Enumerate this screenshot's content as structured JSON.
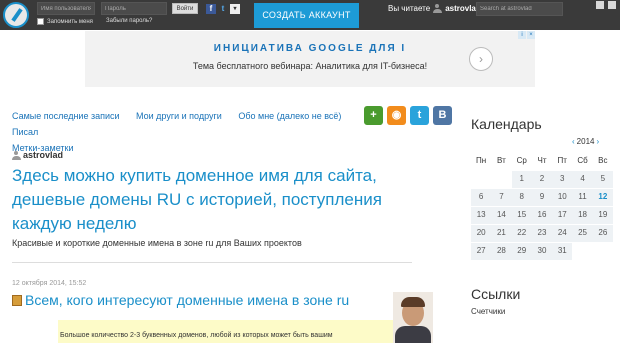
{
  "topbar": {
    "login_placeholder": "Имя пользователя",
    "password_placeholder": "Пароль",
    "enter_label": "Войти",
    "remember_label": "Запомнить меня",
    "forgot_label": "Забыли пароль?",
    "create_account_label": "СОЗДАТЬ АККАУНТ",
    "reading_label": "Вы читаете",
    "reading_user": "astrovlad",
    "search_placeholder": "Search at astrovlad"
  },
  "ad": {
    "title": "ИНИЦИАТИВА GOOGLE ДЛЯ I",
    "subtitle": "Тема бесплатного вебинара: Аналитика для IT-бизнеса!",
    "arrow": "›"
  },
  "nav": {
    "items": [
      "Самые последние записи",
      "Мои други и подруги",
      "Обо мне (далеко не всё)",
      "Писал",
      "Метки-заметки"
    ]
  },
  "social": {
    "plus": "+",
    "rss": "◉",
    "twitter": "t",
    "vk": "B"
  },
  "main": {
    "author": "astrovlad",
    "title": "Здесь можно купить доменное имя для сайта, дешевые домены RU с историей, поступления каждую неделю",
    "subtitle": "Красивые и короткие доменные имена в зоне ru для Ваших проектов",
    "date": "12 октября 2014, 15:52",
    "post_title": "Всем, кого интересуют доменные имена в зоне ru",
    "excerpt": "Большое количество 2-3 буквенных доменов, любой из которых может быть вашим"
  },
  "calendar": {
    "heading": "Календарь",
    "prev": "‹",
    "year": "2014",
    "next": "›",
    "weekdays": [
      "Пн",
      "Вт",
      "Ср",
      "Чт",
      "Пт",
      "Сб",
      "Вс"
    ],
    "weeks": [
      [
        "",
        "",
        "1",
        "2",
        "3",
        "4",
        "5"
      ],
      [
        "6",
        "7",
        "8",
        "9",
        "10",
        "11",
        "12"
      ],
      [
        "13",
        "14",
        "15",
        "16",
        "17",
        "18",
        "19"
      ],
      [
        "20",
        "21",
        "22",
        "23",
        "24",
        "25",
        "26"
      ],
      [
        "27",
        "28",
        "29",
        "30",
        "31",
        "",
        ""
      ]
    ],
    "today": "12"
  },
  "links": {
    "heading": "Ссылки",
    "items": [
      "Счетчики"
    ]
  },
  "colors": {
    "accent": "#1a8fc9",
    "topbar": "#3a3a3a",
    "create_button": "#1d9bd6"
  }
}
